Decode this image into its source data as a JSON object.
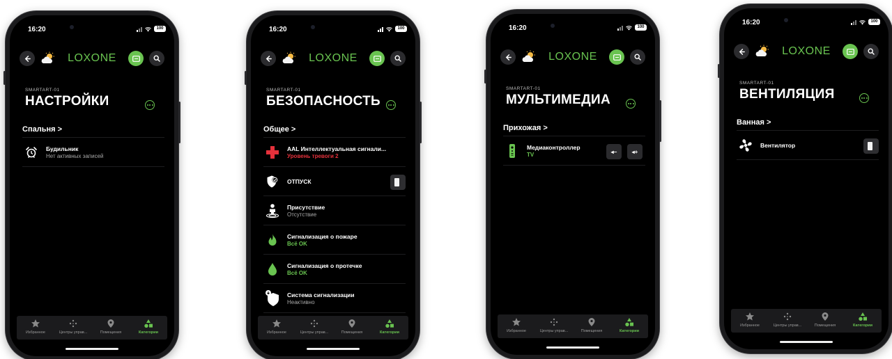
{
  "status": {
    "time": "16:20",
    "battery": "100"
  },
  "app": {
    "logo": "LOXONE",
    "crumb": "SMARTART-01"
  },
  "colors": {
    "accent": "#69c350",
    "alert": "#e5313b",
    "background": "#000000"
  },
  "tabs": [
    {
      "label": "Избранное",
      "icon": "star-icon"
    },
    {
      "label": "Центры управ...",
      "icon": "grid-dots-icon"
    },
    {
      "label": "Помещения",
      "icon": "location-pin-icon"
    },
    {
      "label": "Категории",
      "icon": "categories-icon",
      "active": true
    }
  ],
  "screens": [
    {
      "title": "НАСТРОЙКИ",
      "room": "Спальня >",
      "items": [
        {
          "name": "Будильник",
          "status": "Нет активных записей",
          "icon": "alarm-clock-icon"
        }
      ]
    },
    {
      "title": "БЕЗОПАСНОСТЬ",
      "room": "Общее >",
      "items": [
        {
          "name": "AAL Интеллектуальная сигнали...",
          "status": "Уровень тревоги 2",
          "icon": "medical-cross-icon",
          "status_color": "red"
        },
        {
          "name": "ОТПУСК",
          "status": "",
          "icon": "shield-check-icon",
          "control": "switch"
        },
        {
          "name": "Присутствие",
          "status": "Отсутствие",
          "icon": "person-presence-icon"
        },
        {
          "name": "Сигнализация о пожаре",
          "status": "Всё OK",
          "icon": "flame-icon",
          "status_color": "green"
        },
        {
          "name": "Сигнализация о протечке",
          "status": "Всё OK",
          "icon": "water-drop-icon",
          "status_color": "green"
        },
        {
          "name": "Система сигнализации",
          "status": "Неактивно",
          "icon": "shield-alarm-icon"
        }
      ]
    },
    {
      "title": "МУЛЬТИМЕДИА",
      "room": "Прихожая >",
      "items": [
        {
          "name": "Медиаконтроллер",
          "status": "TV",
          "icon": "remote-control-icon",
          "status_color": "green",
          "control": "volume",
          "vol_down": "◂−",
          "vol_up": "◂+"
        }
      ]
    },
    {
      "title": "ВЕНТИЛЯЦИЯ",
      "room": "Ванная >",
      "items": [
        {
          "name": "Вентилятор",
          "status": "",
          "icon": "fan-icon",
          "control": "switch"
        }
      ]
    }
  ]
}
